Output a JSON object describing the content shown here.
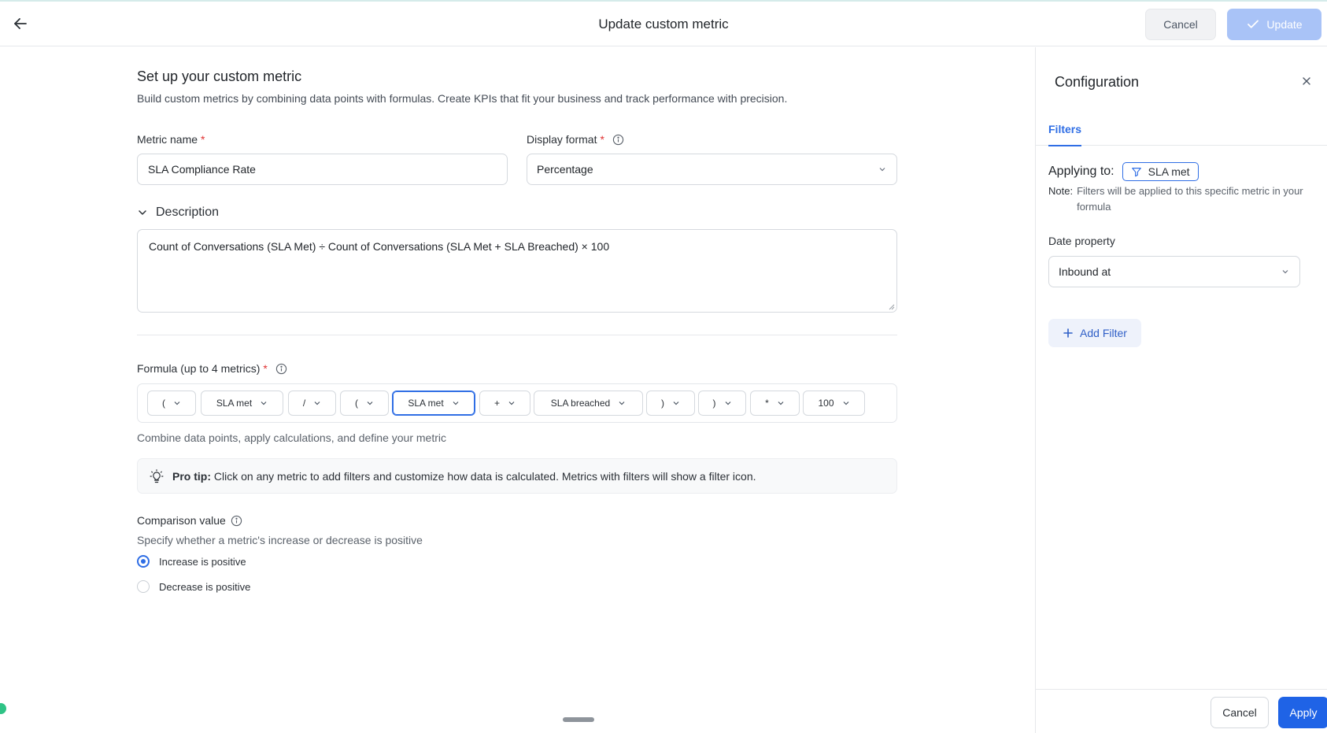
{
  "header": {
    "title": "Update custom metric",
    "cancel_label": "Cancel",
    "update_label": "Update"
  },
  "setup": {
    "title": "Set up your custom metric",
    "subtitle": "Build custom metrics by combining data points with formulas. Create KPIs that fit your business and track performance with precision."
  },
  "metric_name": {
    "label": "Metric name",
    "required_mark": "*",
    "value": "SLA Compliance Rate"
  },
  "display_format": {
    "label": "Display format",
    "required_mark": "*",
    "value": "Percentage"
  },
  "description": {
    "toggle_label": "Description",
    "value": "Count of Conversations (SLA Met) ÷ Count of Conversations (SLA Met + SLA Breached) × 100"
  },
  "formula": {
    "label": "Formula (up to 4 metrics)",
    "required_mark": "*",
    "tokens": [
      "(",
      "SLA met",
      "/",
      "(",
      "SLA met",
      "+",
      "SLA breached",
      ")",
      ")",
      "*",
      "100"
    ],
    "active_token_index": 4,
    "hint": "Combine data points, apply calculations, and define your metric"
  },
  "tip": {
    "bold": "Pro tip:",
    "text": "Click on any metric to add filters and customize how data is calculated. Metrics with filters will show a filter icon."
  },
  "comparison": {
    "label": "Comparison value",
    "subtitle": "Specify whether a metric's increase or decrease is positive",
    "options": [
      "Increase is positive",
      "Decrease is positive"
    ],
    "selected_index": 0
  },
  "panel": {
    "title": "Configuration",
    "tab_label": "Filters",
    "applying_label": "Applying to:",
    "applying_value": "SLA met",
    "note_label": "Note:",
    "note_text": "Filters will be applied to this specific metric in your formula",
    "date_property_label": "Date property",
    "date_property_value": "Inbound at",
    "add_filter_label": "Add Filter",
    "cancel_label": "Cancel",
    "apply_label": "Apply"
  },
  "colors": {
    "accent": "#2f6ee5",
    "update_disabled": "#a9c3f7",
    "required": "#e03131"
  }
}
